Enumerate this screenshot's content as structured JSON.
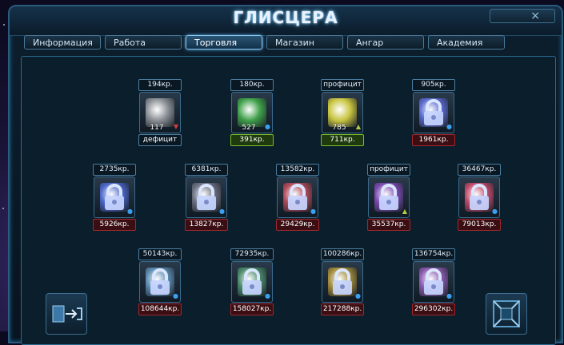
{
  "window": {
    "title": "ГЛИСЦЕРА",
    "close_label": "×"
  },
  "tabs": [
    {
      "label": "Информация",
      "active": false
    },
    {
      "label": "Работа",
      "active": false
    },
    {
      "label": "Торговля",
      "active": true
    },
    {
      "label": "Магазин",
      "active": false
    },
    {
      "label": "Ангар",
      "active": false
    },
    {
      "label": "Академия",
      "active": false
    }
  ],
  "goods": [
    {
      "top": "194кр.",
      "qty": "117",
      "bottom": "дефицит",
      "bottom_style": "dark",
      "locked": false,
      "trend": "down",
      "color": "#8a8f96"
    },
    {
      "top": "180кр.",
      "qty": "527",
      "bottom": "391кр.",
      "bottom_style": "green",
      "locked": false,
      "trend": "dot",
      "color": "#3fa04a"
    },
    {
      "top": "профицит",
      "qty": "785",
      "bottom": "711кр.",
      "bottom_style": "green",
      "locked": false,
      "trend": "up",
      "color": "#c8c440"
    },
    {
      "top": "905кр.",
      "qty": "",
      "bottom": "1961кр.",
      "bottom_style": "red",
      "locked": true,
      "trend": "dot",
      "color": "#5a6ad0"
    },
    {
      "top": "2735кр.",
      "qty": "",
      "bottom": "5926кр.",
      "bottom_style": "red",
      "locked": true,
      "trend": "dot",
      "color": "#4a66c8"
    },
    {
      "top": "6381кр.",
      "qty": "",
      "bottom": "13827кр.",
      "bottom_style": "red",
      "locked": true,
      "trend": "dot",
      "color": "#6a7080"
    },
    {
      "top": "13582кр.",
      "qty": "",
      "bottom": "29429кр.",
      "bottom_style": "red",
      "locked": true,
      "trend": "dot",
      "color": "#b04a5a"
    },
    {
      "top": "профицит",
      "qty": "",
      "bottom": "35537кр.",
      "bottom_style": "red",
      "locked": true,
      "trend": "up",
      "color": "#7a4ab0"
    },
    {
      "top": "36467кр.",
      "qty": "",
      "bottom": "79013кр.",
      "bottom_style": "red",
      "locked": true,
      "trend": "dot",
      "color": "#c04a6a"
    },
    {
      "top": "50143кр.",
      "qty": "",
      "bottom": "108644кр.",
      "bottom_style": "red",
      "locked": true,
      "trend": "dot",
      "color": "#5a8ab0"
    },
    {
      "top": "72935кр.",
      "qty": "",
      "bottom": "158027кр.",
      "bottom_style": "red",
      "locked": true,
      "trend": "dot",
      "color": "#4a8a6a"
    },
    {
      "top": "100286кр.",
      "qty": "",
      "bottom": "217288кр.",
      "bottom_style": "red",
      "locked": true,
      "trend": "dot",
      "color": "#a08a3a"
    },
    {
      "top": "136754кр.",
      "qty": "",
      "bottom": "296302кр.",
      "bottom_style": "red",
      "locked": true,
      "trend": "dot",
      "color": "#8a5ab0"
    }
  ],
  "icons": {
    "left_corner": "transfer-icon",
    "right_corner": "frame-icon"
  }
}
